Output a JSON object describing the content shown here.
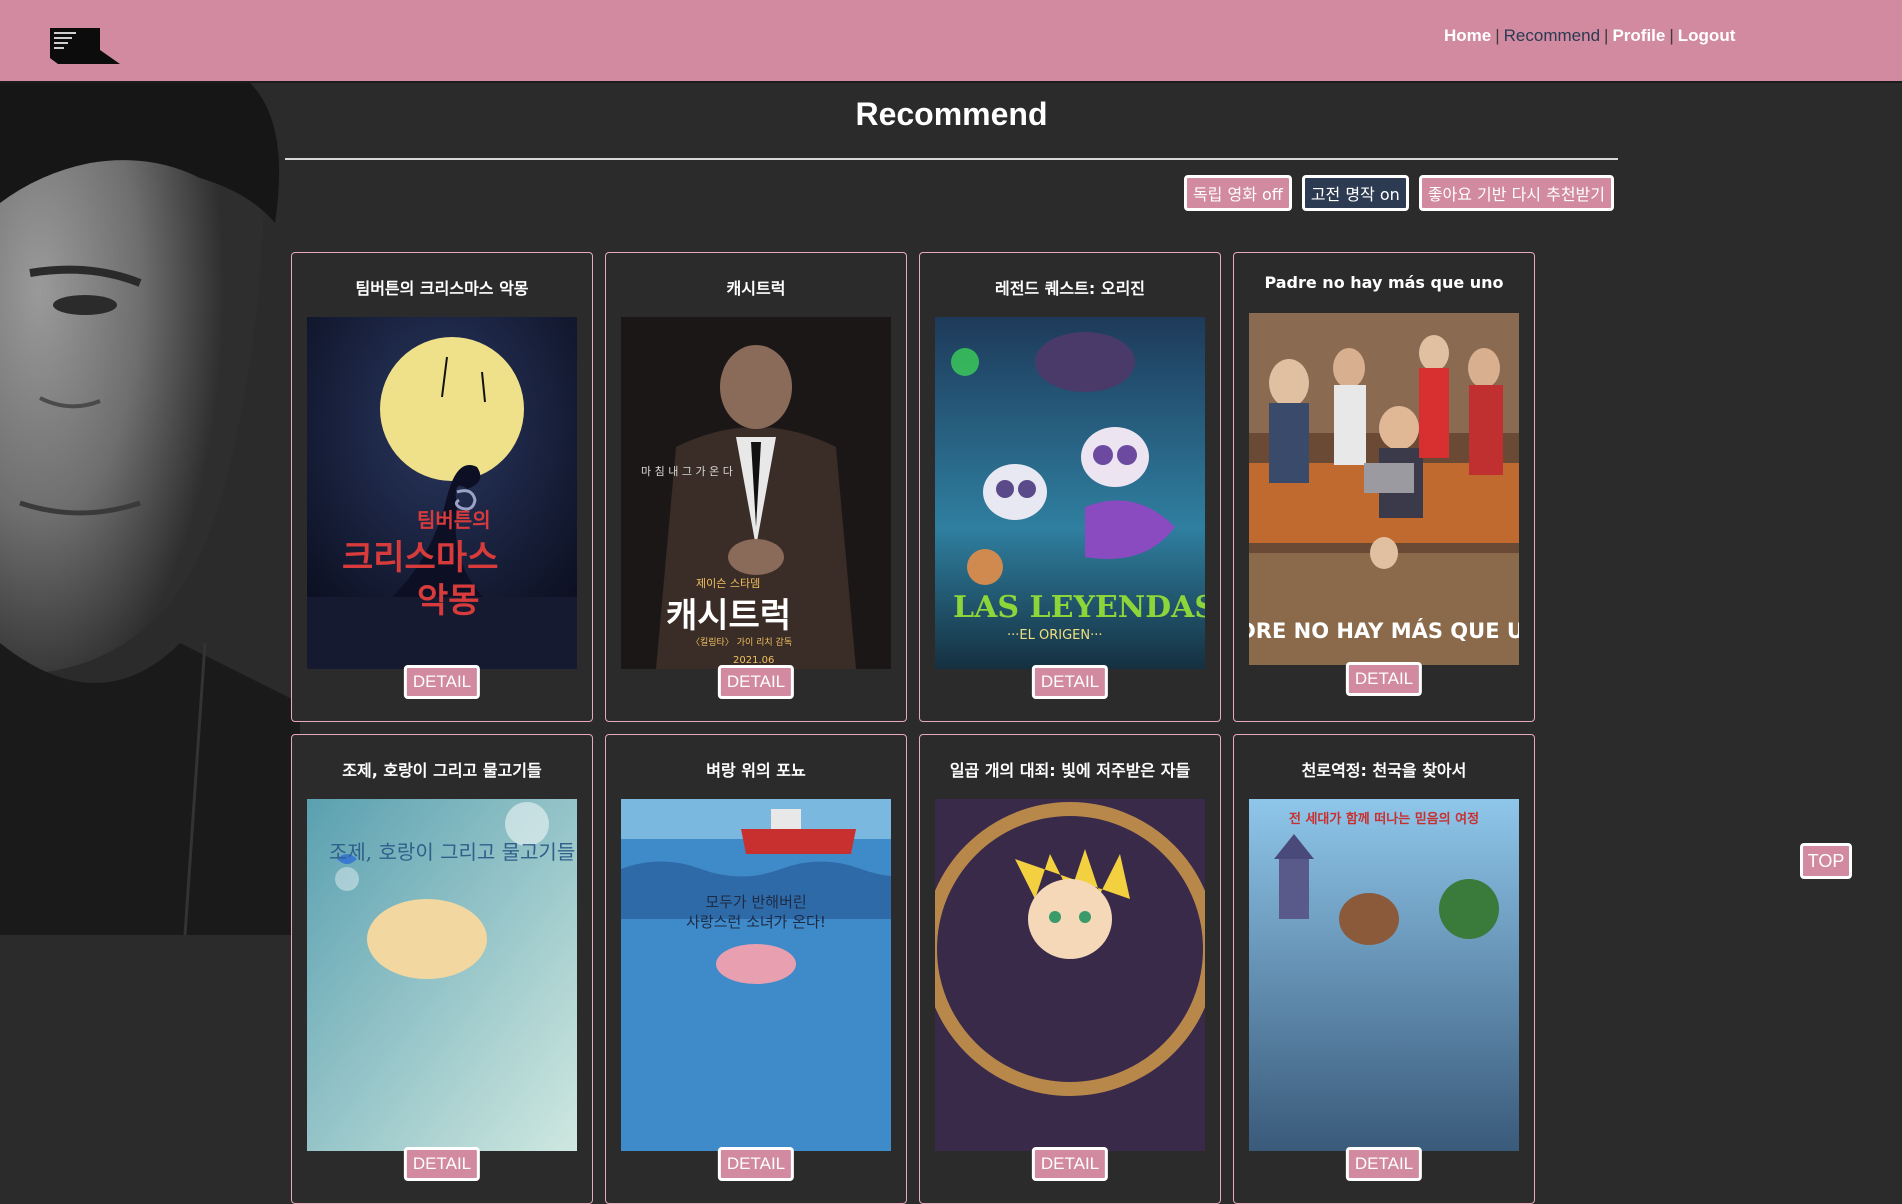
{
  "nav": {
    "home": "Home",
    "recommend": "Recommend",
    "profile": "Profile",
    "logout": "Logout",
    "separator": "|"
  },
  "page": {
    "title": "Recommend"
  },
  "toolbar": {
    "indie": "독립 영화 off",
    "classic": "고전 명작 on",
    "relike": "좋아요 기반 다시 추천받기"
  },
  "movies": [
    {
      "title": "팀버튼의 크리스마스 악몽",
      "detail": "DETAIL"
    },
    {
      "title": "캐시트럭",
      "detail": "DETAIL"
    },
    {
      "title": "레전드 퀘스트: 오리진",
      "detail": "DETAIL"
    },
    {
      "title": "Padre no hay más que uno",
      "detail": "DETAIL"
    },
    {
      "title": "조제, 호랑이 그리고 물고기들",
      "detail": "DETAIL"
    },
    {
      "title": "벼랑 위의 포뇨",
      "detail": "DETAIL"
    },
    {
      "title": "일곱 개의 대죄: 빛에 저주받은 자들",
      "detail": "DETAIL"
    },
    {
      "title": "천로역정: 천국을 찾아서",
      "detail": "DETAIL"
    }
  ],
  "posters": {
    "p1": {
      "line1": "팀버튼의",
      "line2": "크리스마스",
      "line3": "악몽"
    },
    "p2": {
      "tagline": "마 침 내  그 가  온 다",
      "name": "제이슨 스타뎀",
      "title": "캐시트럭",
      "sub": "〈킬링타〉 가이 리치 감독",
      "date": "2021.06"
    },
    "p3": {
      "title": "LAS LEYENDAS",
      "sub": "···EL ORIGEN···"
    },
    "p4": {
      "title": "PADRE NO HAY MÁS QUE UNO"
    },
    "p5": {
      "title": "조제, 호랑이 그리고 물고기들"
    },
    "p6": {
      "line1": "모두가 반해버린",
      "line2": "사랑스런 소녀가 온다!"
    },
    "p8": {
      "tagline": "전 세대가 함께 떠나는 믿음의 여정"
    }
  },
  "top_button": "TOP",
  "colors": {
    "header": "#d18aa0",
    "background": "#2b2b2b",
    "accent_navy": "#2c3a52",
    "card_border": "#e7a9bb"
  }
}
